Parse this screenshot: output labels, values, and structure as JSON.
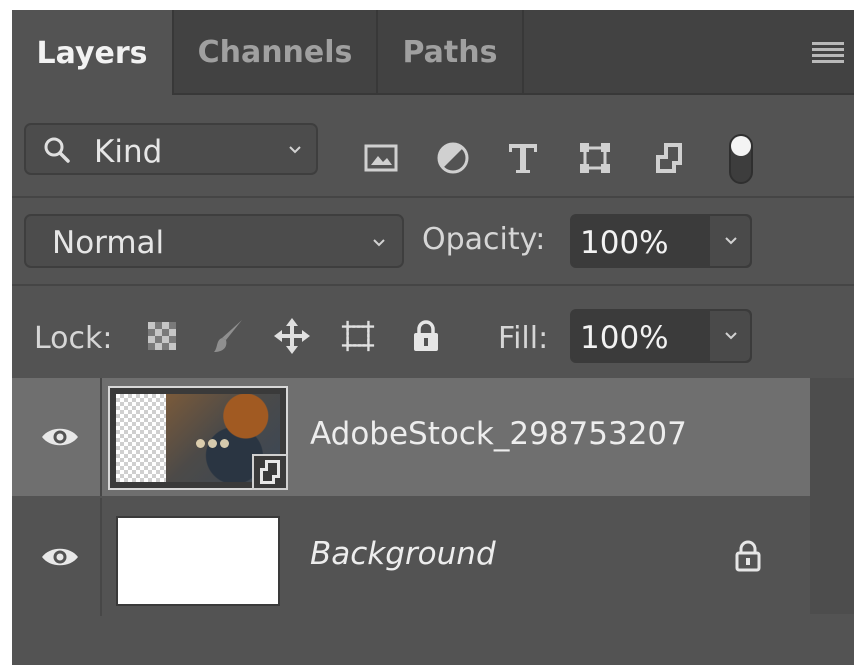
{
  "tabs": [
    {
      "label": "Layers",
      "active": true
    },
    {
      "label": "Channels",
      "active": false
    },
    {
      "label": "Paths",
      "active": false
    }
  ],
  "panel_menu_icon": "hamburger-menu-icon",
  "filter": {
    "kind_label": "Kind",
    "icons": [
      "image-filter-icon",
      "adjustment-filter-icon",
      "type-filter-icon",
      "shape-filter-icon",
      "smart-object-filter-icon",
      "filter-toggle-icon"
    ]
  },
  "blend": {
    "mode": "Normal",
    "opacity_label": "Opacity:",
    "opacity_value": "100%"
  },
  "lock": {
    "label": "Lock:",
    "icons": [
      "lock-transparent-pixels-icon",
      "lock-image-pixels-icon",
      "lock-position-icon",
      "lock-artboard-icon",
      "lock-all-icon"
    ],
    "fill_label": "Fill:",
    "fill_value": "100%"
  },
  "layers": [
    {
      "name": "AdobeStock_298753207",
      "selected": true,
      "visible": true,
      "type": "smart-object",
      "italic": false,
      "locked": false
    },
    {
      "name": "Background",
      "selected": false,
      "visible": true,
      "type": "background",
      "italic": true,
      "locked": true
    }
  ],
  "colors": {
    "panel_bg": "#535353",
    "tabbar_bg": "#424242",
    "selected_row": "#6f6f6f",
    "field_bg": "#3b3b3b",
    "text": "#e6e6e6"
  }
}
